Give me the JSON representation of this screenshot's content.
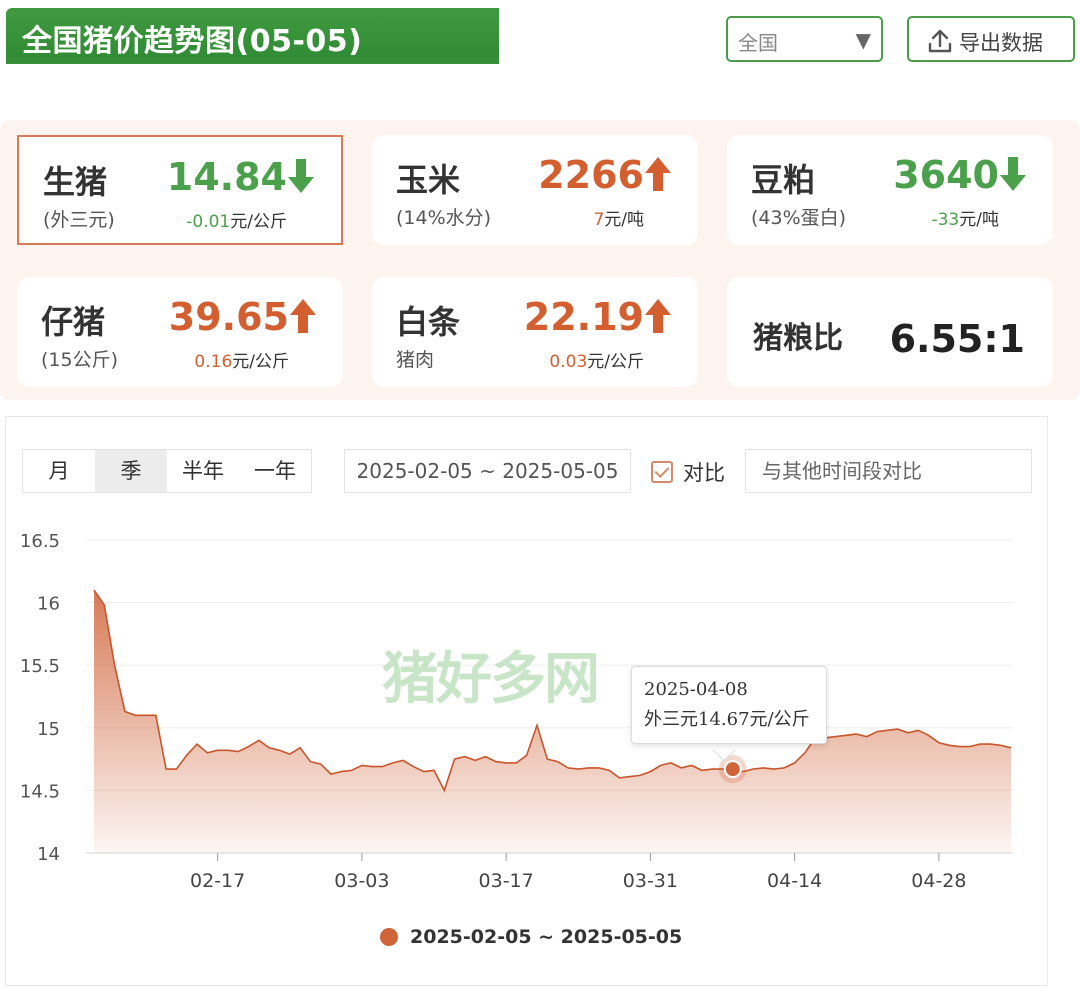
{
  "header": {
    "title": "全国猪价趋势图(05-05)",
    "region": "全国",
    "export_label": "导出数据"
  },
  "cards": [
    {
      "name": "生猪",
      "sub": "(外三元)",
      "price": "14.84",
      "direction": "down",
      "change": "-0.01",
      "unit": "元/公斤"
    },
    {
      "name": "玉米",
      "sub": "(14%水分)",
      "price": "2266",
      "direction": "up",
      "change": "7",
      "unit": "元/吨"
    },
    {
      "name": "豆粕",
      "sub": "(43%蛋白)",
      "price": "3640",
      "direction": "down",
      "change": "-33",
      "unit": "元/吨"
    },
    {
      "name": "仔猪",
      "sub": "(15公斤)",
      "price": "39.65",
      "direction": "up",
      "change": "0.16",
      "unit": "元/公斤"
    },
    {
      "name": "白条",
      "sub": "猪肉",
      "price": "22.19",
      "direction": "up",
      "change": "0.03",
      "unit": "元/公斤"
    },
    {
      "name": "猪粮比",
      "value": "6.55:1"
    }
  ],
  "controls": {
    "periods": [
      "月",
      "季",
      "半年",
      "一年"
    ],
    "active_period": "季",
    "date_range": "2025-02-05 ~ 2025-05-05",
    "compare_label": "对比",
    "compare_placeholder": "与其他时间段对比"
  },
  "watermark": "猪好多网",
  "tooltip": {
    "date": "2025-04-08",
    "text": "外三元14.67元/公斤"
  },
  "colors": {
    "green": "#4ba04b",
    "red": "#d35f30",
    "line": "#d0643a",
    "brand_green": "#3f9a3f"
  },
  "chart_data": {
    "type": "area",
    "ylim": [
      14,
      16.5
    ],
    "yticks": [
      14,
      14.5,
      15,
      15.5,
      16,
      16.5
    ],
    "xlim": [
      "2025-02-05",
      "2025-05-05"
    ],
    "xticks": [
      "02-17",
      "03-03",
      "03-17",
      "03-31",
      "04-14",
      "04-28"
    ],
    "legend": "2025-02-05 ~ 2025-05-05",
    "highlight": {
      "x": "2025-04-08",
      "y": 14.67
    },
    "series": [
      {
        "x": [
          "2025-02-05",
          "2025-02-06",
          "2025-02-07",
          "2025-02-08",
          "2025-02-09",
          "2025-02-10",
          "2025-02-11",
          "2025-02-12",
          "2025-02-13",
          "2025-02-14",
          "2025-02-15",
          "2025-02-16",
          "2025-02-17",
          "2025-02-18",
          "2025-02-19",
          "2025-02-20",
          "2025-02-21",
          "2025-02-22",
          "2025-02-23",
          "2025-02-24",
          "2025-02-25",
          "2025-02-26",
          "2025-02-27",
          "2025-02-28",
          "2025-03-01",
          "2025-03-02",
          "2025-03-03",
          "2025-03-04",
          "2025-03-05",
          "2025-03-06",
          "2025-03-07",
          "2025-03-08",
          "2025-03-09",
          "2025-03-10",
          "2025-03-11",
          "2025-03-12",
          "2025-03-13",
          "2025-03-14",
          "2025-03-15",
          "2025-03-16",
          "2025-03-17",
          "2025-03-18",
          "2025-03-19",
          "2025-03-20",
          "2025-03-21",
          "2025-03-22",
          "2025-03-23",
          "2025-03-24",
          "2025-03-25",
          "2025-03-26",
          "2025-03-27",
          "2025-03-28",
          "2025-03-29",
          "2025-03-30",
          "2025-03-31",
          "2025-04-01",
          "2025-04-02",
          "2025-04-03",
          "2025-04-04",
          "2025-04-05",
          "2025-04-06",
          "2025-04-07",
          "2025-04-08",
          "2025-04-09",
          "2025-04-10",
          "2025-04-11",
          "2025-04-12",
          "2025-04-13",
          "2025-04-14",
          "2025-04-15",
          "2025-04-16",
          "2025-04-17",
          "2025-04-18",
          "2025-04-19",
          "2025-04-20",
          "2025-04-21",
          "2025-04-22",
          "2025-04-23",
          "2025-04-24",
          "2025-04-25",
          "2025-04-26",
          "2025-04-27",
          "2025-04-28",
          "2025-04-29",
          "2025-04-30",
          "2025-05-01",
          "2025-05-02",
          "2025-05-03",
          "2025-05-04",
          "2025-05-05"
        ],
        "y": [
          16.1,
          15.98,
          15.5,
          15.13,
          15.1,
          15.1,
          15.1,
          14.67,
          14.67,
          14.78,
          14.87,
          14.8,
          14.82,
          14.82,
          14.81,
          14.85,
          14.9,
          14.84,
          14.82,
          14.79,
          14.84,
          14.73,
          14.71,
          14.63,
          14.65,
          14.66,
          14.7,
          14.69,
          14.69,
          14.72,
          14.74,
          14.69,
          14.65,
          14.66,
          14.5,
          14.75,
          14.77,
          14.74,
          14.77,
          14.73,
          14.72,
          14.72,
          14.78,
          15.02,
          14.75,
          14.73,
          14.68,
          14.67,
          14.68,
          14.68,
          14.66,
          14.6,
          14.61,
          14.62,
          14.65,
          14.7,
          14.72,
          14.68,
          14.7,
          14.66,
          14.67,
          14.67,
          14.67,
          14.65,
          14.67,
          14.68,
          14.67,
          14.68,
          14.72,
          14.8,
          14.92,
          14.92,
          14.93,
          14.94,
          14.95,
          14.93,
          14.97,
          14.98,
          14.99,
          14.96,
          14.98,
          14.94,
          14.88,
          14.86,
          14.85,
          14.85,
          14.87,
          14.87,
          14.86,
          14.84
        ]
      }
    ]
  }
}
